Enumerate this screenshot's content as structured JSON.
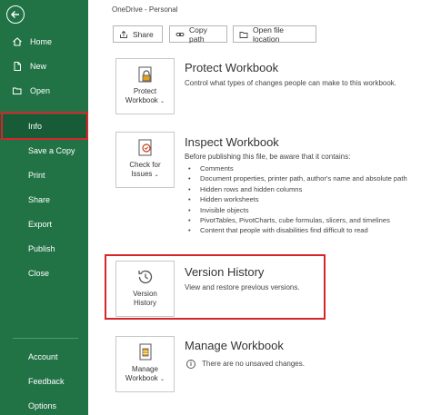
{
  "sidebar": {
    "items": [
      {
        "label": "Home",
        "icon": "home-icon"
      },
      {
        "label": "New",
        "icon": "new-file-icon"
      },
      {
        "label": "Open",
        "icon": "folder-open-icon"
      },
      {
        "label": "Info"
      },
      {
        "label": "Save a Copy"
      },
      {
        "label": "Print"
      },
      {
        "label": "Share"
      },
      {
        "label": "Export"
      },
      {
        "label": "Publish"
      },
      {
        "label": "Close"
      },
      {
        "label": "Account"
      },
      {
        "label": "Feedback"
      },
      {
        "label": "Options"
      }
    ],
    "active": "Info",
    "background": "#217346",
    "highlight_color": "#d8242b"
  },
  "header": {
    "location": "OneDrive - Personal",
    "buttons": [
      "Share",
      "Copy path",
      "Open file location"
    ]
  },
  "sections": {
    "protect": {
      "button_line1": "Protect",
      "button_line2": "Workbook",
      "title": "Protect Workbook",
      "description": "Control what types of changes people can make to this workbook."
    },
    "inspect": {
      "button_line1": "Check for",
      "button_line2": "Issues",
      "title": "Inspect Workbook",
      "description": "Before publishing this file, be aware that it contains:",
      "bullets": [
        "Comments",
        "Document properties, printer path, author's name and absolute path",
        "Hidden rows and hidden columns",
        "Hidden worksheets",
        "Invisible objects",
        "PivotTables, PivotCharts, cube formulas, slicers, and timelines",
        "Content that people with disabilities find difficult to read"
      ]
    },
    "version": {
      "button_line1": "Version",
      "button_line2": "History",
      "title": "Version History",
      "description": "View and restore previous versions."
    },
    "manage": {
      "button_line1": "Manage",
      "button_line2": "Workbook",
      "title": "Manage Workbook",
      "description": "There are no unsaved changes."
    }
  }
}
